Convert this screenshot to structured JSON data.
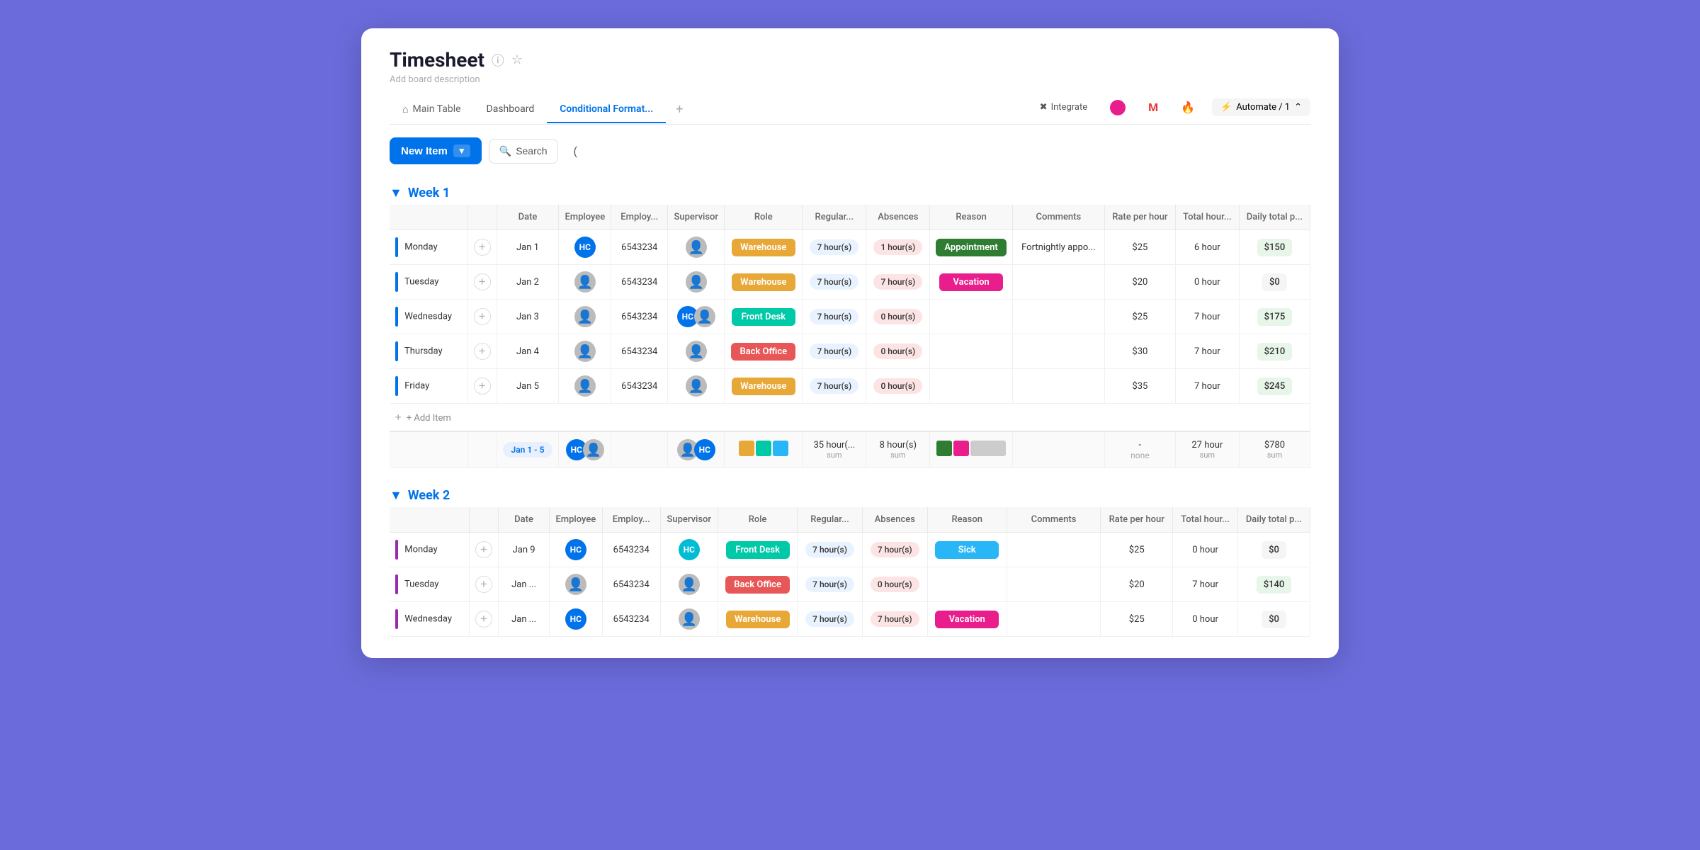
{
  "app": {
    "title": "Timesheet",
    "description": "Add board description",
    "tabs": [
      {
        "label": "Main Table",
        "icon": "home",
        "active": false
      },
      {
        "label": "Dashboard",
        "icon": "",
        "active": false
      },
      {
        "label": "Conditional Format...",
        "icon": "",
        "active": true
      },
      {
        "label": "+",
        "icon": "",
        "active": false
      }
    ],
    "tab_right": {
      "integrate": "Integrate",
      "automate": "Automate / 1"
    }
  },
  "toolbar": {
    "new_item": "New Item",
    "search": "Search"
  },
  "week1": {
    "title": "Week 1",
    "columns": [
      "",
      "Date",
      "Employee",
      "Employ...",
      "Supervisor",
      "Role",
      "Regular...",
      "Absences",
      "Reason",
      "Comments",
      "Rate per hour",
      "Total hour...",
      "Daily total p..."
    ],
    "rows": [
      {
        "day": "Monday",
        "date": "Jan 1",
        "employee_initials": "HC",
        "employee_color": "blue",
        "employ_no": "6543234",
        "supervisor": "person",
        "role": "Warehouse",
        "role_type": "warehouse",
        "regular": "7 hour(s)",
        "absences": "1 hour(s)",
        "absence_type": "nonzero",
        "reason": "Appointment",
        "reason_type": "appointment",
        "comments": "Fortnightly appo...",
        "rate": "$25",
        "total_hours": "6 hour",
        "daily_total": "$150",
        "indicator": "blue"
      },
      {
        "day": "Tuesday",
        "date": "Jan 2",
        "employee_initials": "",
        "employee_color": "gray",
        "employ_no": "6543234",
        "supervisor": "person",
        "role": "Warehouse",
        "role_type": "warehouse",
        "regular": "7 hour(s)",
        "absences": "7 hour(s)",
        "absence_type": "nonzero",
        "reason": "Vacation",
        "reason_type": "vacation",
        "comments": "",
        "rate": "$20",
        "total_hours": "0 hour",
        "daily_total": "$0",
        "indicator": "blue"
      },
      {
        "day": "Wednesday",
        "date": "Jan 3",
        "employee_initials": "",
        "employee_color": "gray",
        "employ_no": "6543234",
        "supervisor_has_badge": true,
        "supervisor_initials": "HC",
        "role": "Front Desk",
        "role_type": "frontdesk",
        "regular": "7 hour(s)",
        "absences": "0 hour(s)",
        "absence_type": "zero",
        "reason": "",
        "reason_type": "none",
        "comments": "",
        "rate": "$25",
        "total_hours": "7 hour",
        "daily_total": "$175",
        "indicator": "blue"
      },
      {
        "day": "Thursday",
        "date": "Jan 4",
        "employee_initials": "",
        "employee_color": "gray",
        "employ_no": "6543234",
        "supervisor": "person",
        "role": "Back Office",
        "role_type": "backoffice",
        "regular": "7 hour(s)",
        "absences": "0 hour(s)",
        "absence_type": "zero",
        "reason": "",
        "reason_type": "none",
        "comments": "",
        "rate": "$30",
        "total_hours": "7 hour",
        "daily_total": "$210",
        "indicator": "blue"
      },
      {
        "day": "Friday",
        "date": "Jan 5",
        "employee_initials": "",
        "employee_color": "gray",
        "employ_no": "6543234",
        "supervisor": "person",
        "role": "Warehouse",
        "role_type": "warehouse",
        "regular": "7 hour(s)",
        "absences": "0 hour(s)",
        "absence_type": "zero",
        "reason": "",
        "reason_type": "none",
        "comments": "",
        "rate": "$35",
        "total_hours": "7 hour",
        "daily_total": "$245",
        "indicator": "blue"
      }
    ],
    "add_item": "+ Add Item",
    "summary": {
      "date_range": "Jan 1 - 5",
      "regular_sum": "35 hour(...",
      "regular_label": "sum",
      "absences_sum": "8 hour(s)",
      "absences_label": "sum",
      "rate_label": "-",
      "rate_sublabel": "none",
      "total_hours": "27 hour",
      "total_label": "sum",
      "daily_total": "$780",
      "daily_label": "sum"
    }
  },
  "week2": {
    "title": "Week 2",
    "columns": [
      "",
      "Date",
      "Employee",
      "Employ...",
      "Supervisor",
      "Role",
      "Regular...",
      "Absences",
      "Reason",
      "Comments",
      "Rate per hour",
      "Total hour...",
      "Daily total p..."
    ],
    "rows": [
      {
        "day": "Monday",
        "date": "Jan 9",
        "employee_initials": "HC",
        "employee_color": "blue",
        "employ_no": "6543234",
        "supervisor_initials": "HC",
        "supervisor_color": "teal",
        "role": "Front Desk",
        "role_type": "frontdesk",
        "regular": "7 hour(s)",
        "absences": "7 hour(s)",
        "absence_type": "nonzero",
        "reason": "Sick",
        "reason_type": "sick",
        "comments": "",
        "rate": "$25",
        "total_hours": "0 hour",
        "daily_total": "$0",
        "indicator": "purple"
      },
      {
        "day": "Tuesday",
        "date": "Jan ...",
        "employee_initials": "",
        "employee_color": "gray",
        "employ_no": "6543234",
        "supervisor": "person",
        "role": "Back Office",
        "role_type": "backoffice",
        "regular": "7 hour(s)",
        "absences": "0 hour(s)",
        "absence_type": "zero",
        "reason": "",
        "reason_type": "none",
        "comments": "",
        "rate": "$20",
        "total_hours": "7 hour",
        "daily_total": "$140",
        "indicator": "purple"
      },
      {
        "day": "Wednesday",
        "date": "Jan ...",
        "employee_initials": "HC",
        "employee_color": "blue",
        "employ_no": "6543234",
        "supervisor": "person",
        "role": "Warehouse",
        "role_type": "warehouse",
        "regular": "7 hour(s)",
        "absences": "7 hour(s)",
        "absence_type": "nonzero",
        "reason": "Vacation",
        "reason_type": "vacation",
        "comments": "",
        "rate": "$25",
        "total_hours": "0 hour",
        "daily_total": "$0",
        "indicator": "purple"
      }
    ]
  },
  "colors": {
    "brand_blue": "#0073ea",
    "brand_purple": "#6b6bdb",
    "green": "#2e7d32",
    "pink": "#e91e8c",
    "teal": "#00bcd4",
    "orange": "#e8a838"
  }
}
